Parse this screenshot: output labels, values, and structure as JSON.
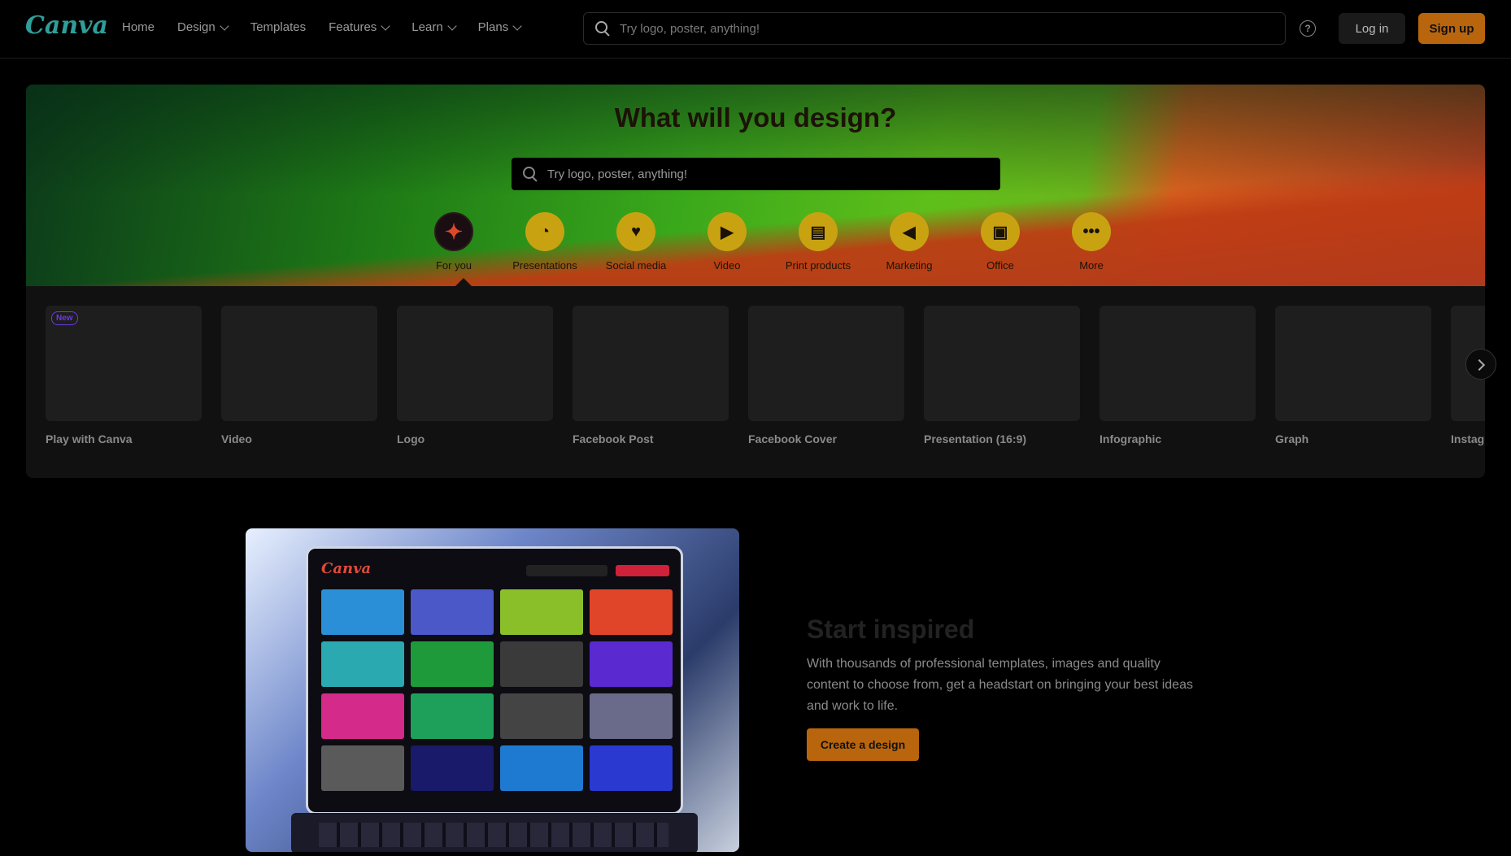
{
  "nav": {
    "logo": "Canva",
    "links": [
      "Home",
      "Design",
      "Templates",
      "Features",
      "Learn",
      "Plans"
    ],
    "search_placeholder": "Try logo, poster, anything!",
    "help_glyph": "?",
    "login": "Log in",
    "signup": "Sign up"
  },
  "hero": {
    "title": "What will you design?",
    "search_placeholder": "Try logo, poster, anything!",
    "categories": [
      {
        "label": "For you",
        "icon": "sparkle-icon"
      },
      {
        "label": "Presentations",
        "icon": "presentation-icon"
      },
      {
        "label": "Social media",
        "icon": "heart-chat-icon"
      },
      {
        "label": "Video",
        "icon": "video-camera-icon"
      },
      {
        "label": "Print products",
        "icon": "printer-icon"
      },
      {
        "label": "Marketing",
        "icon": "megaphone-icon"
      },
      {
        "label": "Office",
        "icon": "briefcase-icon"
      },
      {
        "label": "More",
        "icon": "more-dots-icon"
      }
    ]
  },
  "carousel": {
    "badge": "New",
    "tiles": [
      "Play with Canva",
      "Video",
      "Logo",
      "Facebook Post",
      "Facebook Cover",
      "Presentation (16:9)",
      "Infographic",
      "Graph",
      "Instag"
    ]
  },
  "promo": {
    "title": "Start inspired",
    "text": "With thousands of professional templates, images and quality content to choose from, get a headstart on bringing your best ideas and work to life.",
    "button": "Create a design"
  },
  "colors": {
    "accent": "#b8650d",
    "category_circle": "#c9a212",
    "hero_green": "#3aa81b",
    "hero_orange": "#d8611e"
  }
}
